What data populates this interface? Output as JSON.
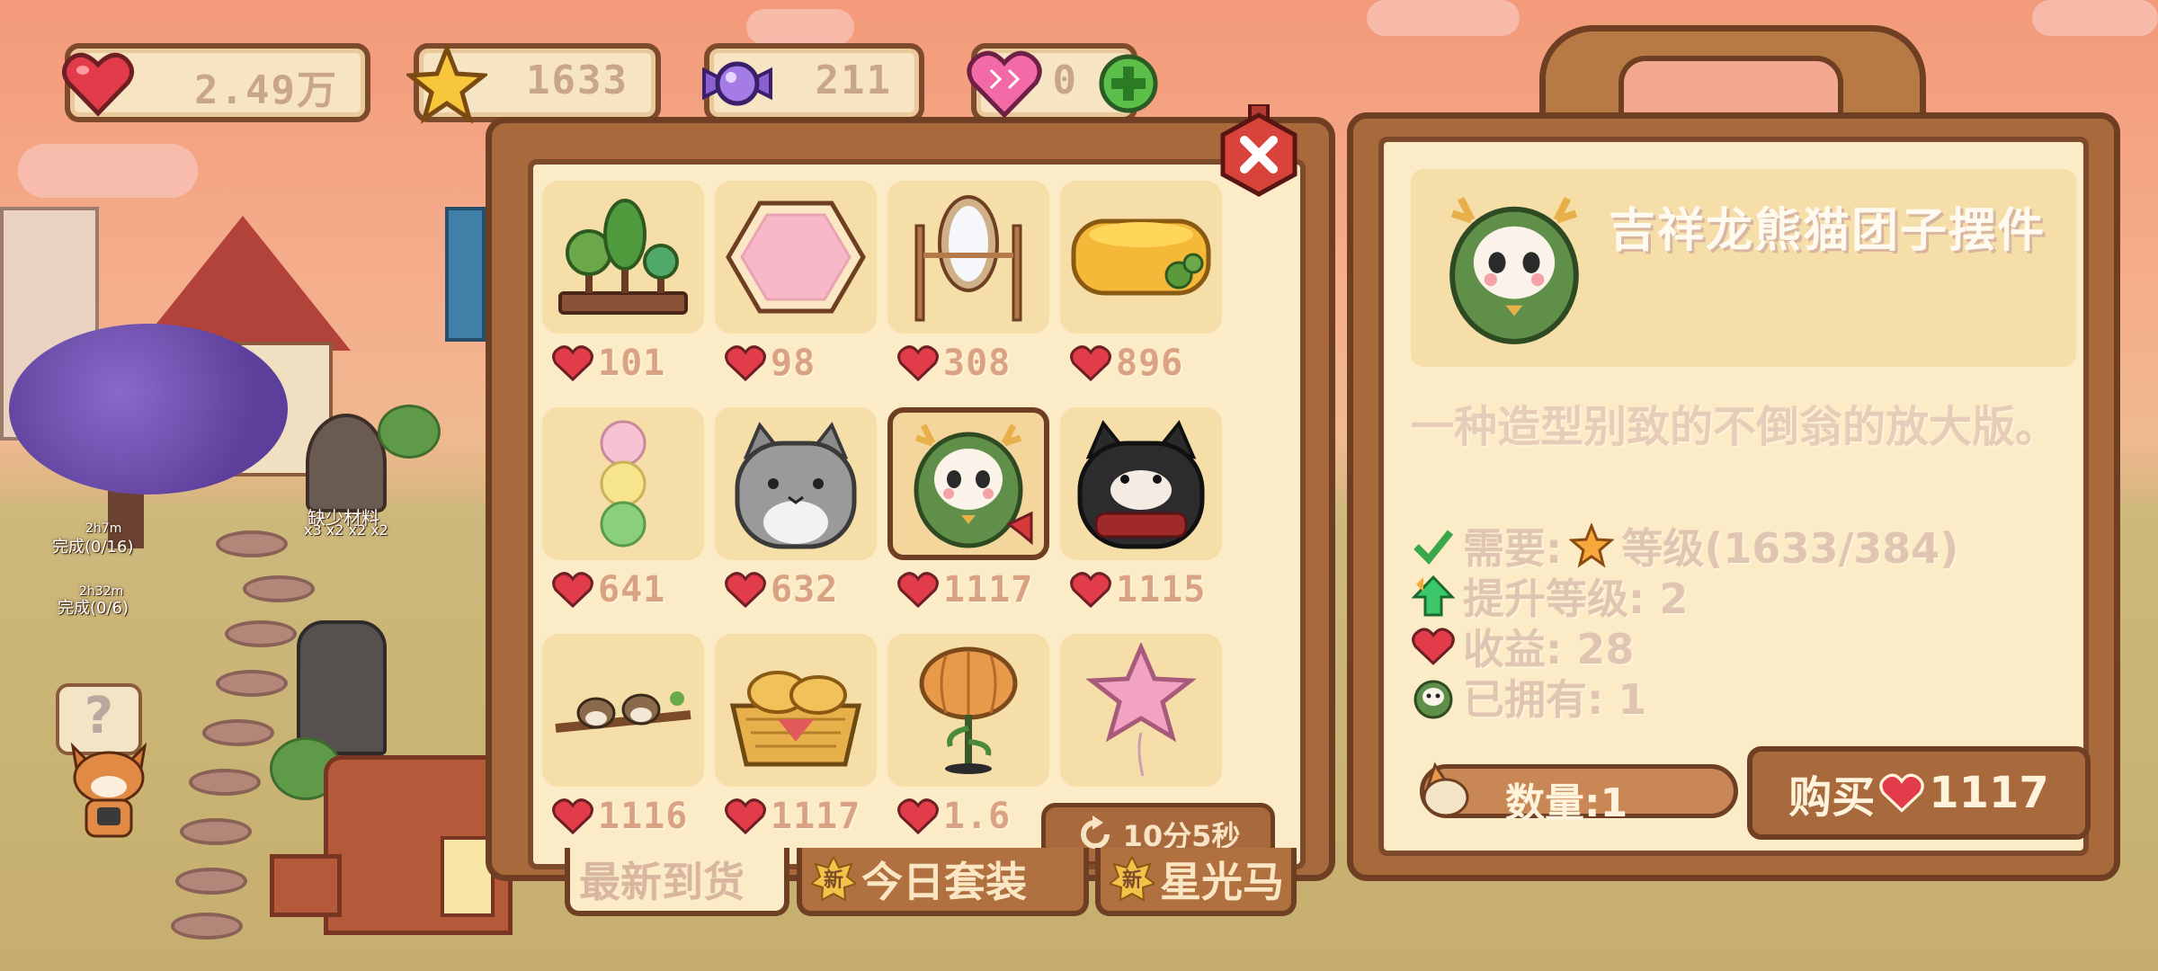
{
  "resources": {
    "hearts": "2.49万",
    "stars": "1633",
    "candy": "211",
    "pink_hearts": "0"
  },
  "scene": {
    "missing_materials": "缺少材料",
    "missing_counts": "x3 x2 x2 x2",
    "timer_a": "2h7m",
    "progress_a": "完成(0/16)",
    "timer_b": "2h32m",
    "progress_b": "完成(0/6)",
    "question_mark": "?"
  },
  "shop": {
    "items": [
      {
        "name": "盆栽树",
        "price": "101",
        "icon": "tree-planter-icon"
      },
      {
        "name": "粉色地毯",
        "price": "98",
        "icon": "pink-rug-icon"
      },
      {
        "name": "落地镜",
        "price": "308",
        "icon": "mirror-icon"
      },
      {
        "name": "奶酪",
        "price": "896",
        "icon": "cheese-icon"
      },
      {
        "name": "三色团子",
        "price": "641",
        "icon": "dango-icon"
      },
      {
        "name": "灰猫靠垫",
        "price": "632",
        "icon": "gray-cat-cushion-icon"
      },
      {
        "name": "吉祥龙熊猫团子摆件",
        "price": "1117",
        "icon": "dragon-panda-doll-icon"
      },
      {
        "name": "黑猫靠垫",
        "price": "1115",
        "icon": "black-cat-cushion-icon"
      },
      {
        "name": "树枝小鸟",
        "price": "1116",
        "icon": "birds-on-branch-icon"
      },
      {
        "name": "面包篮",
        "price": "1117",
        "icon": "bread-basket-icon"
      },
      {
        "name": "南瓜灯",
        "price": "1.6",
        "icon": "pumpkin-lamp-icon"
      },
      {
        "name": "星星气球",
        "price": "",
        "icon": "star-balloon-icon"
      }
    ],
    "timer": "10分5秒",
    "tabs": [
      {
        "label": "最新到货",
        "new": false
      },
      {
        "label": "今日套装",
        "new": true
      },
      {
        "label": "星光马",
        "new": true
      }
    ],
    "new_badge": "新"
  },
  "detail": {
    "title": "吉祥龙熊猫团子摆件",
    "description": "一种造型别致的不倒翁的放大版。",
    "need_label": "需要:",
    "need_value": "等级(1633/384)",
    "level_up": "提升等级: 2",
    "income": "收益: 28",
    "owned": "已拥有: 1",
    "quantity": "数量:1",
    "buy_label": "购买",
    "buy_price": "1117"
  },
  "colors": {
    "frame": "#6e3f22",
    "panel": "#fbebc6",
    "price_text": "#d9a383",
    "heart": "#e23b4a"
  }
}
